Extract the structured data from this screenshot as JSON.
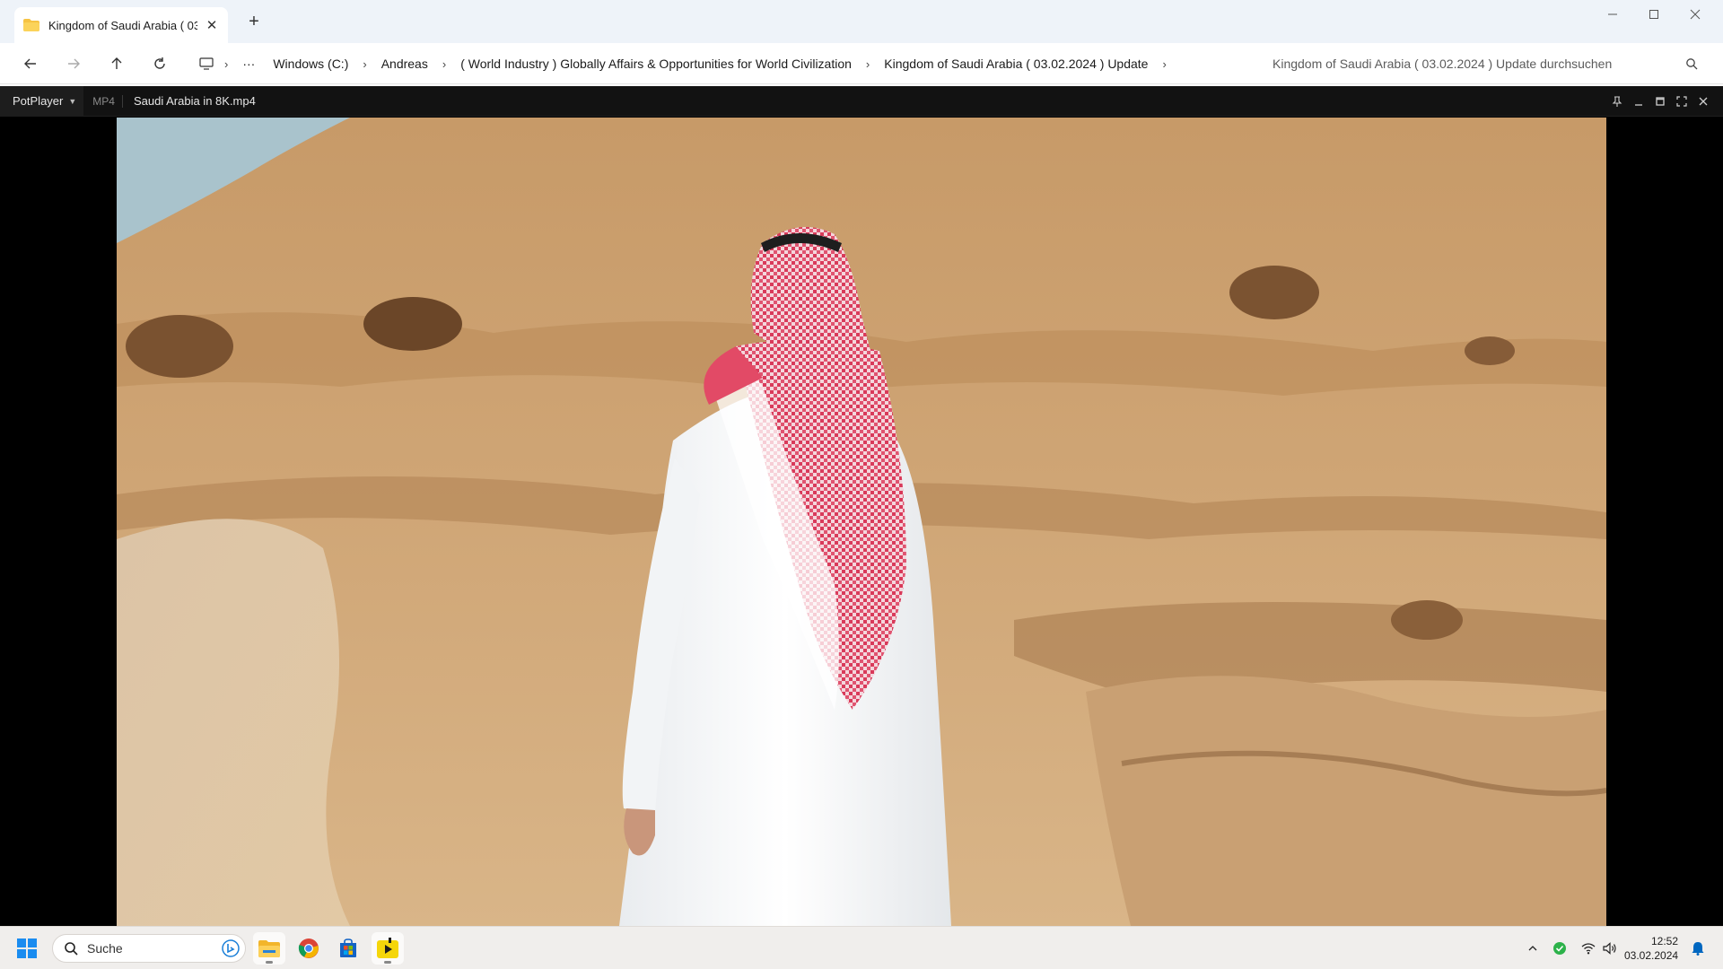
{
  "explorer": {
    "tab_title": "Kingdom of Saudi Arabia ( 03.02.2024 ) Update",
    "new_tab_symbol": "+",
    "breadcrumbs": [
      "Windows (C:)",
      "Andreas",
      "( World Industry ) Globally Affairs & Opportunities for World Civilization",
      "Kingdom of Saudi Arabia ( 03.02.2024 ) Update"
    ],
    "overflow_symbol": "···",
    "search_placeholder": "Kingdom of Saudi Arabia ( 03.02.2024 ) Update durchsuchen"
  },
  "player": {
    "menu_label": "PotPlayer",
    "format_label": "MP4",
    "file_name": "Saudi Arabia in 8K.mp4"
  },
  "taskbar": {
    "search_placeholder": "Suche",
    "time": "12:52",
    "date": "03.02.2024",
    "pinned_apps": [
      "file-explorer",
      "chrome",
      "microsoft-store",
      "potplayer"
    ]
  },
  "colors": {
    "accent": "#0067c0",
    "folder_yellow": "#f6c343",
    "player_bg": "#000000",
    "sand": "#c99a64"
  }
}
